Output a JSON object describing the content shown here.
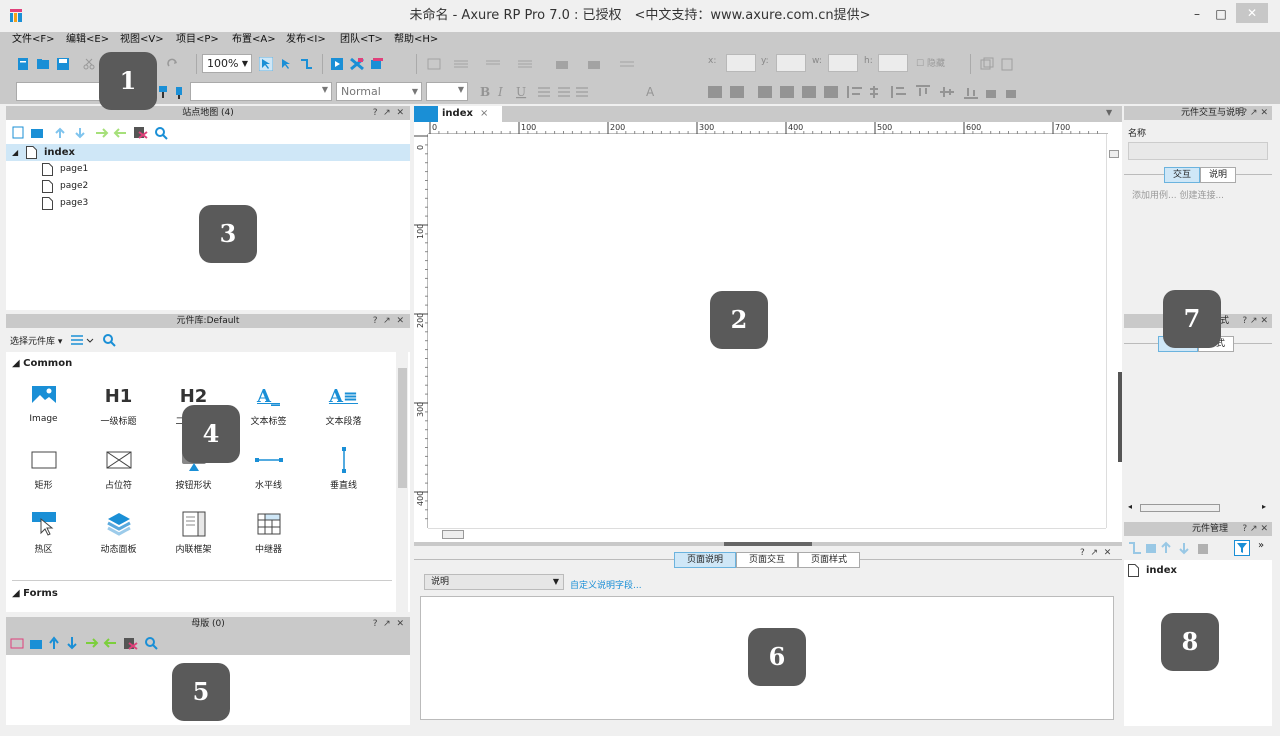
{
  "window": {
    "title": "未命名 - Axure RP Pro 7.0 : 已授权　<中文支持：www.axure.com.cn提供>",
    "minimize": "–",
    "maximize": "□",
    "close": "✕"
  },
  "menu": [
    "文件<F>",
    "编辑<E>",
    "视图<V>",
    "项目<P>",
    "布置<A>",
    "发布<I>",
    "团队<T>",
    "帮助<H>"
  ],
  "toolbar": {
    "zoom": "100%",
    "style_select": "Normal",
    "x_label": "x:",
    "y_label": "y:",
    "w_label": "w:",
    "h_label": "h:",
    "hidden_label": "隐藏"
  },
  "sitemap": {
    "title": "站点地图 (4)",
    "pages": [
      {
        "name": "index"
      },
      {
        "name": "page1"
      },
      {
        "name": "page2"
      },
      {
        "name": "page3"
      }
    ]
  },
  "library": {
    "title": "元件库:Default",
    "select_label": "选择元件库",
    "sections": [
      {
        "name": "Common",
        "widgets": [
          {
            "icon": "image-icon",
            "label": "Image"
          },
          {
            "icon": "h1-icon",
            "glyph": "H1",
            "label": "一级标题"
          },
          {
            "icon": "h2-icon",
            "glyph": "H2",
            "label": "二级标题"
          },
          {
            "icon": "text-label-icon",
            "glyph": "A_",
            "label": "文本标签"
          },
          {
            "icon": "text-paragraph-icon",
            "glyph": "A≡",
            "label": "文本段落"
          },
          {
            "icon": "rectangle-icon",
            "label": "矩形"
          },
          {
            "icon": "placeholder-icon",
            "label": "占位符"
          },
          {
            "icon": "button-shape-icon",
            "label": "按钮形状"
          },
          {
            "icon": "horizontal-line-icon",
            "label": "水平线"
          },
          {
            "icon": "vertical-line-icon",
            "label": "垂直线"
          },
          {
            "icon": "hotspot-icon",
            "label": "热区"
          },
          {
            "icon": "dynamic-panel-icon",
            "label": "动态面板"
          },
          {
            "icon": "inline-frame-icon",
            "label": "内联框架"
          },
          {
            "icon": "repeater-icon",
            "label": "中继器"
          }
        ]
      },
      {
        "name": "Forms",
        "widgets": []
      }
    ]
  },
  "masters": {
    "title": "母版 (0)"
  },
  "canvas": {
    "tab": "index",
    "ruler_h": [
      "0",
      "100",
      "200",
      "300",
      "400",
      "500",
      "600",
      "700"
    ],
    "ruler_v": [
      "0",
      "100",
      "200",
      "300",
      "400"
    ]
  },
  "page_props": {
    "tabs": [
      "页面说明",
      "页面交互",
      "页面样式"
    ],
    "select_value": "说明",
    "custom_link": "自定义说明字段..."
  },
  "interactions": {
    "title": "元件交互与说明",
    "name_label": "名称",
    "tabs": [
      "交互",
      "说明"
    ],
    "hint": "添加用例...  创建连接..."
  },
  "widget_props": {
    "title_partial": "式",
    "tab_partial": "样式"
  },
  "widget_manager": {
    "title": "元件管理",
    "items": [
      "index"
    ]
  },
  "badges": [
    "1",
    "2",
    "3",
    "4",
    "5",
    "6",
    "7",
    "8"
  ],
  "colors": {
    "accent_blue": "#1a8fd6",
    "selected_row": "#cfe7f7",
    "badge_bg": "#5a5a5a",
    "panel_header": "#c9c9c9"
  }
}
